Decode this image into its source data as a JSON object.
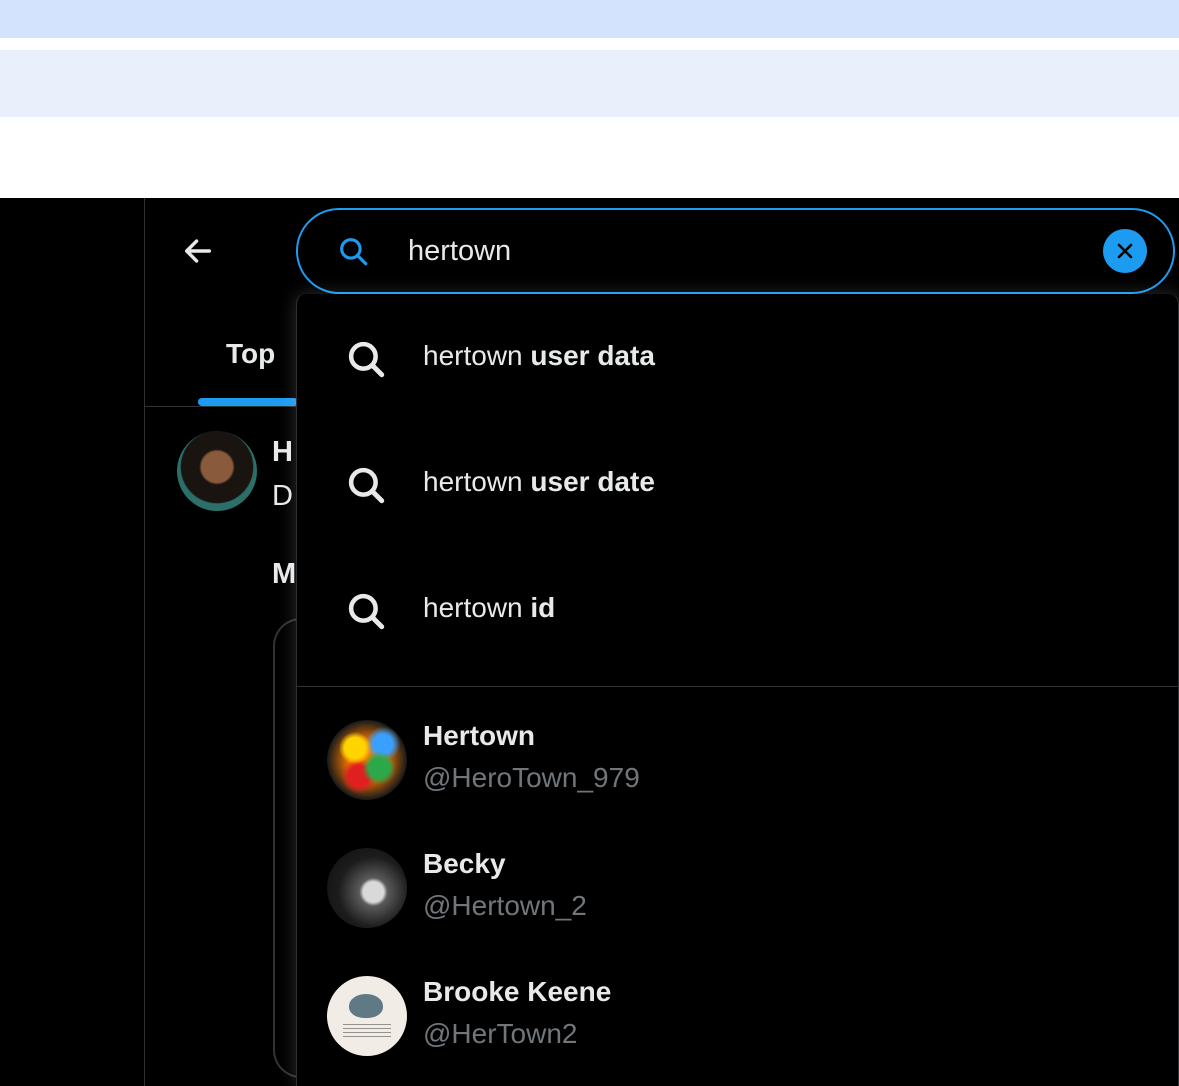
{
  "search": {
    "value": "hertown",
    "placeholder": ""
  },
  "tabs": [
    {
      "label": "Top",
      "active": true
    }
  ],
  "background_post": {
    "name_peek": "H",
    "line_peek": "D",
    "more_peek": "M"
  },
  "query_suggestions": [
    {
      "prefix": "hertown",
      "bold": " user data"
    },
    {
      "prefix": "hertown",
      "bold": " user date"
    },
    {
      "prefix": "hertown",
      "bold": " id"
    }
  ],
  "user_suggestions": [
    {
      "name": "Hertown",
      "handle": "@HeroTown_979"
    },
    {
      "name": "Becky",
      "handle": "@Hertown_2"
    },
    {
      "name": "Brooke Keene",
      "handle": "@HerTown2"
    }
  ],
  "icons": {
    "back": "arrow-left-icon",
    "search": "search-icon",
    "clear": "close-icon",
    "suggestion": "search-icon"
  },
  "colors": {
    "accent": "#1d9bf0",
    "text": "#e7e9ea",
    "secondary_text": "#71767b",
    "border": "#2f3336",
    "background": "#000000"
  }
}
